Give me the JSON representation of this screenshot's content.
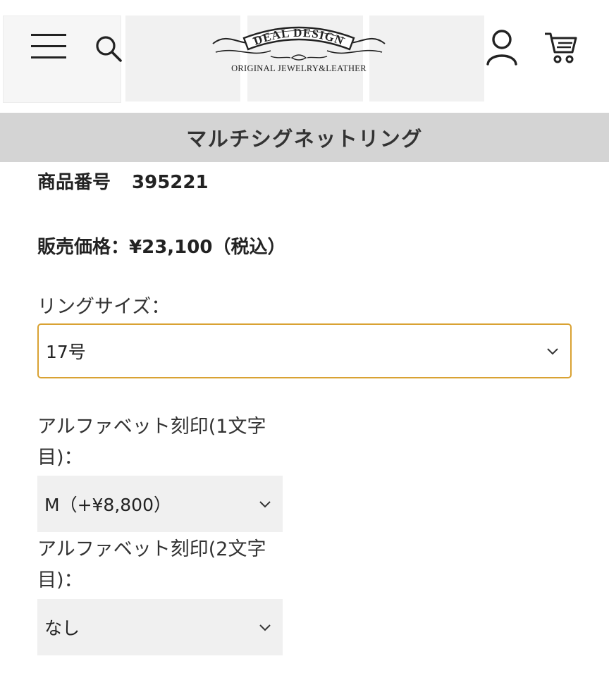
{
  "header": {
    "logo": {
      "brand": "DEAL DESIGN",
      "tagline": "ORIGINAL JEWELRY&LEATHER"
    },
    "icons": {
      "menu": "hamburger-menu-icon",
      "search": "search-icon",
      "account": "account-icon",
      "cart": "cart-icon"
    }
  },
  "title_bar": {
    "title": "マルチシグネットリング"
  },
  "product": {
    "number_label": "商品番号",
    "number": "395221",
    "price_label": "販売価格：",
    "price": "¥23,100（税込）"
  },
  "options": {
    "ring_size": {
      "label": "リングサイズ：",
      "selected": "17号"
    },
    "engrave1": {
      "label": "アルファベット刻印(1文字目)：",
      "selected": "M（+¥8,800）"
    },
    "engrave2": {
      "label": "アルファベット刻印(2文字目)：",
      "selected": "なし"
    }
  },
  "colors": {
    "accent_border": "#d9a233",
    "title_bar_bg": "#d4d4d4",
    "select_bg": "#f0f0f0"
  }
}
